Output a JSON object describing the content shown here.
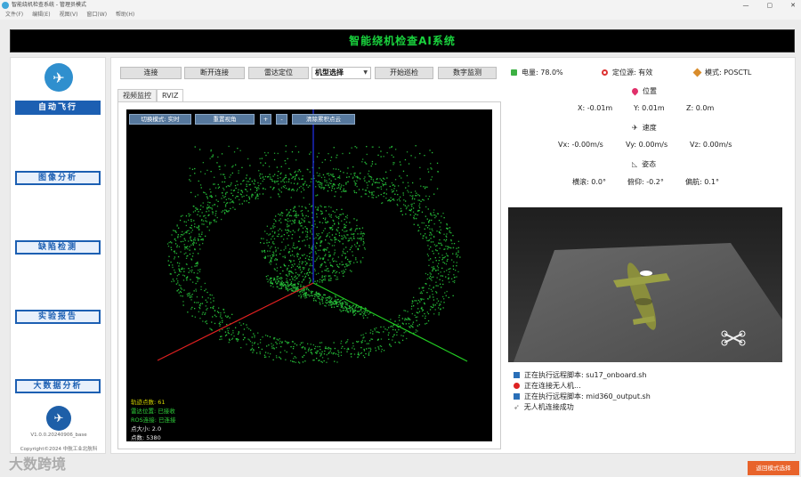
{
  "window": {
    "title": "智能绕机检查系统 - 管理员模式",
    "controls": [
      "—",
      "▢",
      "✕"
    ]
  },
  "menu": [
    "文件(F)",
    "编辑(E)",
    "视图(V)",
    "窗口(W)",
    "帮助(H)"
  ],
  "banner": "智能绕机检查AI系统",
  "sidebar": {
    "buttons": [
      "自动飞行",
      "图像分析",
      "缺陷检测",
      "实验报告",
      "大数据分析"
    ],
    "version": "V1.0.0.20240906_base",
    "copyright": "Copyright©2024 中航工业北航科"
  },
  "toolbar": {
    "connect": "连接",
    "disconnect": "断开连接",
    "radar_locate": "雷达定位",
    "model_select": "机型选择",
    "start_patrol": "开始巡检",
    "digital_twin": "数字监测"
  },
  "tabs": [
    "视频监控",
    "RVIZ"
  ],
  "viewer": {
    "mode_btn": "切换模式: 实时",
    "reset_btn": "重置视角",
    "plus_btn": "+",
    "minus_btn": "-",
    "clear_btn": "清除累积点云",
    "track_points": "轨迹点数: 61",
    "radar_pos": "雷达位置: 已接收",
    "ros_conn": "ROS连接: 已连接",
    "point_size": "点大小: 2.0",
    "point_count": "点数: 5380"
  },
  "status": {
    "battery": "电量: 78.0%",
    "loc_source": "定位源: 有效",
    "mode": "模式: POSCTL",
    "position_title": "位置",
    "x": "X: -0.01m",
    "y": "Y: 0.01m",
    "z": "Z: 0.0m",
    "velocity_title": "速度",
    "vx": "Vx: -0.00m/s",
    "vy": "Vy: 0.00m/s",
    "vz": "Vz: 0.00m/s",
    "attitude_title": "姿态",
    "roll": "横滚: 0.0°",
    "pitch": "俯仰: -0.2°",
    "yaw": "偏航: 0.1°"
  },
  "log": [
    "正在执行远程脚本: su17_onboard.sh",
    "正在连接无人机...",
    "正在执行远程脚本: mid360_output.sh",
    "无人机连接成功"
  ],
  "return_button": "返回模式选择",
  "watermark": "大数跨境",
  "colors": {
    "accent": "#1c5fb2",
    "banner_text": "#19d33d",
    "points": "#27c43a",
    "return_btn": "#e8632b"
  }
}
